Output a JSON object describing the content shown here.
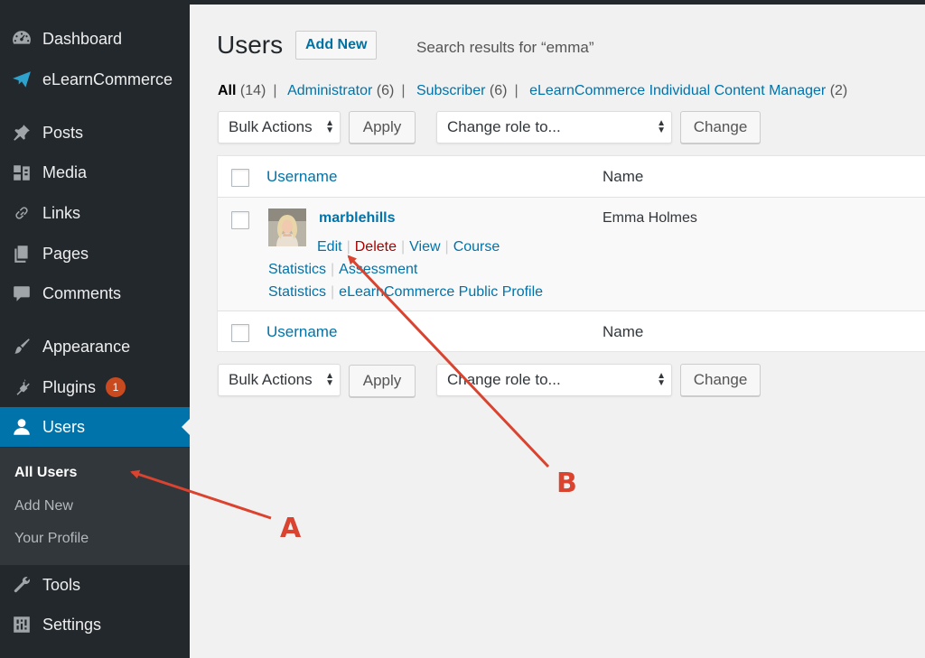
{
  "sidebar": {
    "items": [
      {
        "label": "Dashboard",
        "icon": "dashboard-icon"
      },
      {
        "label": "eLearnCommerce",
        "icon": "paper-plane-icon"
      },
      {
        "label": "Posts",
        "icon": "pin-icon"
      },
      {
        "label": "Media",
        "icon": "media-icon"
      },
      {
        "label": "Links",
        "icon": "link-icon"
      },
      {
        "label": "Pages",
        "icon": "pages-icon"
      },
      {
        "label": "Comments",
        "icon": "comment-icon"
      },
      {
        "label": "Appearance",
        "icon": "brush-icon"
      },
      {
        "label": "Plugins",
        "icon": "plug-icon",
        "badge": "1"
      },
      {
        "label": "Users",
        "icon": "user-icon",
        "active": true
      },
      {
        "label": "Tools",
        "icon": "wrench-icon"
      },
      {
        "label": "Settings",
        "icon": "settings-icon"
      }
    ],
    "submenu": [
      "All Users",
      "Add New",
      "Your Profile"
    ]
  },
  "header": {
    "title": "Users",
    "add_new": "Add New",
    "search_results": "Search results for “emma”"
  },
  "filters": [
    {
      "label": "All",
      "count": "(14)"
    },
    {
      "label": "Administrator",
      "count": "(6)"
    },
    {
      "label": "Subscriber",
      "count": "(6)"
    },
    {
      "label": "eLearnCommerce Individual Content Manager",
      "count": "(2)"
    }
  ],
  "tablenav": {
    "bulk_actions": "Bulk Actions",
    "apply": "Apply",
    "change_role": "Change role to...",
    "change": "Change"
  },
  "table": {
    "col_username": "Username",
    "col_name": "Name",
    "rows": [
      {
        "username": "marblehills",
        "name": "Emma Holmes",
        "actions": [
          "Edit",
          "Delete",
          "View",
          "Course Statistics",
          "Assessment Statistics",
          "eLearnCommerce Public Profile"
        ]
      }
    ]
  },
  "annotations": {
    "a": "A",
    "b": "B",
    "color": "#d9432f"
  },
  "colors": {
    "sidebar_bg": "#23282d",
    "accent": "#0073aa",
    "delete": "#a00",
    "badge": "#ca4a1f"
  }
}
